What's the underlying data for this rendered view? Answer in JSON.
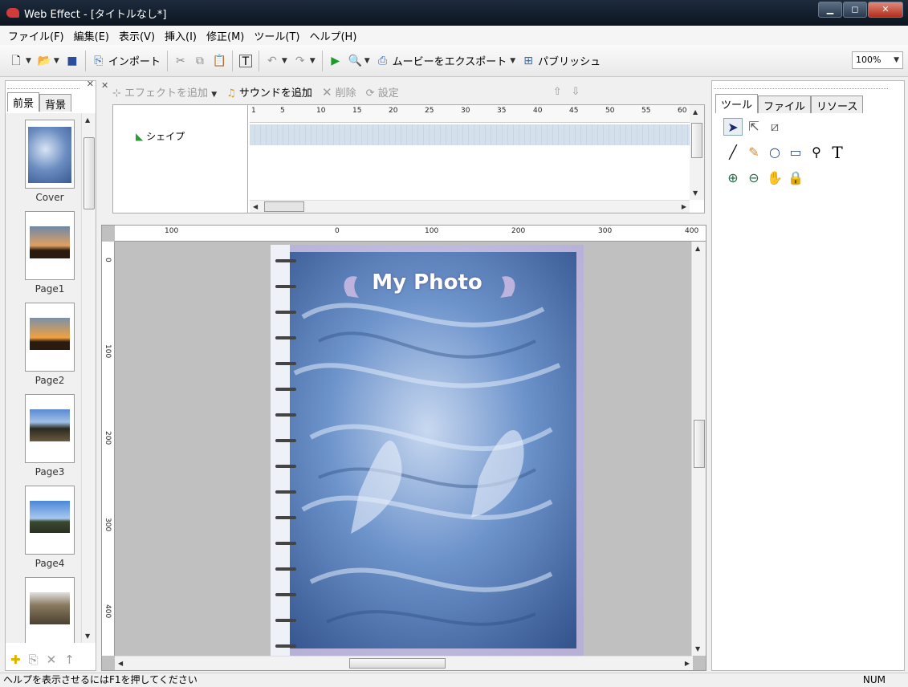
{
  "window": {
    "title": "Web Effect - [タイトルなし*]"
  },
  "menu": [
    "ファイル(F)",
    "編集(E)",
    "表示(V)",
    "挿入(I)",
    "修正(M)",
    "ツール(T)",
    "ヘルプ(H)"
  ],
  "toolbar": {
    "import_label": "インポート",
    "export_label": "ムービーをエクスポート",
    "publish_label": "パブリッシュ",
    "zoom": "100%"
  },
  "left_panel": {
    "tabs": [
      "前景",
      "背景"
    ],
    "pages": [
      {
        "label": "Cover"
      },
      {
        "label": "Page1"
      },
      {
        "label": "Page2"
      },
      {
        "label": "Page3"
      },
      {
        "label": "Page4"
      },
      {
        "label": ""
      }
    ]
  },
  "timeline": {
    "add_effect": "エフェクトを追加",
    "add_sound": "サウンドを追加",
    "delete": "削除",
    "settings": "設定",
    "layer_name": "シェイプ",
    "ruler": [
      "1",
      "5",
      "10",
      "15",
      "20",
      "25",
      "30",
      "35",
      "40",
      "45",
      "50",
      "55",
      "60"
    ]
  },
  "stage": {
    "hruler": [
      "100",
      "0",
      "100",
      "200",
      "300",
      "400"
    ],
    "vruler": [
      "0",
      "100",
      "200",
      "300",
      "400"
    ],
    "canvas_title": "My Photo"
  },
  "right_panel": {
    "tabs": [
      "ツール",
      "ファイル",
      "リソース"
    ]
  },
  "status": {
    "help": "ヘルプを表示させるにはF1を押してください",
    "num": "NUM"
  },
  "colors": {
    "titlebar": "#0c1520",
    "frames": "#d4e0ec",
    "canvas": "#5a7fb4"
  }
}
